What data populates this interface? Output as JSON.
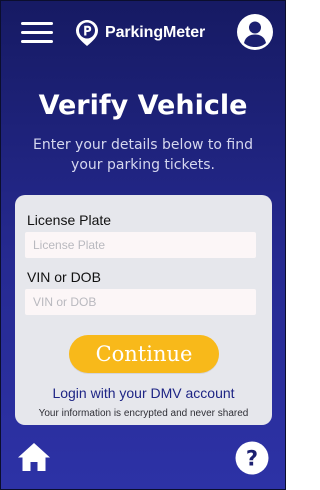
{
  "app": {
    "name": "ParkingMeter"
  },
  "header": {
    "menu_icon": "hamburger-menu-icon",
    "logo_icon": "parking-pin-icon",
    "profile_icon": "user-avatar-icon"
  },
  "page": {
    "title": "Verify Vehicle",
    "subtitle": "Enter your details below to find your parking tickets."
  },
  "form": {
    "license_plate": {
      "label": "License Plate",
      "placeholder": "License Plate",
      "value": ""
    },
    "vin_or_dob": {
      "label": "VIN or DOB",
      "placeholder": "VIN or DOB",
      "value": ""
    },
    "submit_label": "Continue",
    "dmv_login_link": "Login with your DMV account",
    "security_note": "Your information is encrypted and never shared"
  },
  "footer": {
    "home_icon": "home-icon",
    "help_icon": "help-icon"
  },
  "colors": {
    "background_top": "#161a63",
    "background_bottom": "#2d32a6",
    "card": "#e6e7ec",
    "accent_button": "#f8b91a",
    "link": "#1e2585"
  }
}
